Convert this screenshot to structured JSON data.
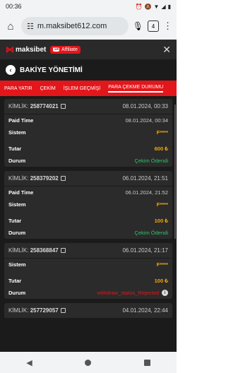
{
  "status": {
    "time": "00:36"
  },
  "browser": {
    "url": "m.maksibet612.com",
    "tab_count": "4"
  },
  "site": {
    "brand": "maksibet",
    "affiliate_label": "Affiliate"
  },
  "page": {
    "title": "BAKİYE YÖNETİMİ"
  },
  "tabs": [
    {
      "label": "PARA YATIR"
    },
    {
      "label": "ÇEKİM"
    },
    {
      "label": "İŞLEM GEÇMİŞİ"
    },
    {
      "label": "PARA ÇEKME DURUMU"
    }
  ],
  "labels": {
    "kimlik": "KİMLİK:",
    "paid_time": "Paid Time",
    "sistem": "Sistem",
    "tutar": "Tutar",
    "durum": "Durum"
  },
  "transactions": [
    {
      "id": "258774021",
      "date": "08.01.2024, 00:33",
      "paid_time": "08.01.2024, 00:34",
      "sistem": "F****",
      "tutar": "600 ₺",
      "durum": "Çekim Ödendi"
    },
    {
      "id": "258379202",
      "date": "06.01.2024, 21:51",
      "paid_time": "06.01.2024, 21:52",
      "sistem": "F****",
      "tutar": "100 ₺",
      "durum": "Çekim Ödendi"
    },
    {
      "id": "258368847",
      "date": "06.01.2024, 21:17",
      "sistem": "F****",
      "tutar": "100 ₺",
      "durum": "withdraw_status_Rejected"
    },
    {
      "id": "257729057",
      "date": "04.01.2024, 22:44"
    }
  ]
}
